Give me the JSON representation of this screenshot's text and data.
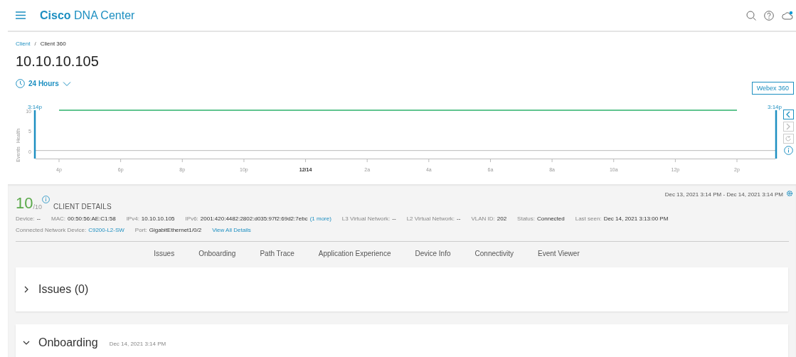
{
  "header": {
    "brand_bold": "Cisco",
    "brand": "DNA Center"
  },
  "breadcrumb": [
    {
      "label": "Client",
      "kind": "link"
    },
    {
      "label": "/",
      "kind": "separator"
    },
    {
      "label": "Client 360",
      "kind": "current"
    }
  ],
  "title": "10.10.10.105",
  "time_range": {
    "label": "24 Hours"
  },
  "webex_button": "Webex 360",
  "timeline": {
    "events_label": "Events",
    "start_marker": "3:14p",
    "end_marker": "3:14p",
    "chart_data": {
      "type": "line",
      "ylabel": "Health",
      "ylim": [
        -2,
        10
      ],
      "yticks": [
        0,
        5,
        10
      ],
      "categories": [
        "4p",
        "6p",
        "8p",
        "10p",
        "12/14",
        "2a",
        "4a",
        "6a",
        "8a",
        "10a",
        "12p",
        "2p"
      ],
      "series": [
        {
          "color": "#2bb06a",
          "values": [
            10,
            10,
            10,
            10,
            10,
            10,
            10,
            10,
            10,
            10,
            10,
            10
          ]
        }
      ]
    },
    "controls": [
      {
        "kind": "back",
        "disabled": false
      },
      {
        "kind": "forward",
        "disabled": true
      },
      {
        "kind": "reset",
        "disabled": true
      }
    ]
  },
  "client": {
    "score": "10",
    "score_max": "/10",
    "heading": "CLIENT DETAILS",
    "date_range": "Dec 13, 2021 3:14 PM - Dec 14, 2021 3:14 PM",
    "identity": [
      {
        "label": "Device:",
        "value": "--",
        "kind": "text"
      },
      {
        "label": "MAC:",
        "value": "00:50:56:AE:C1:58",
        "kind": "text"
      },
      {
        "label": "IPv4:",
        "value": "10.10.10.105",
        "kind": "text"
      },
      {
        "label": "IPv6:",
        "value": "2001:420:4482:2802:d035:97f2:69d2:7ebc",
        "link": "(1 more)",
        "kind": "text"
      },
      {
        "label": "L3 Virtual Network:",
        "value": "--",
        "kind": "text"
      },
      {
        "label": "L2 Virtual Network:",
        "value": "--",
        "kind": "text"
      },
      {
        "label": "VLAN ID:",
        "value": "202",
        "kind": "text"
      },
      {
        "label": "Status:",
        "value": "Connected",
        "kind": "text"
      },
      {
        "label": "Last seen:",
        "value": "Dec 14, 2021 3:13:00 PM",
        "kind": "text"
      }
    ],
    "connection": {
      "device_label": "Connected Network Device:",
      "device": "C9200-L2-SW",
      "port_label": "Port:",
      "port": "GigabitEthernet1/0/2"
    },
    "view_all": "View All Details"
  },
  "tabs": [
    {
      "label": "Issues",
      "selected": false
    },
    {
      "label": "Onboarding",
      "selected": false
    },
    {
      "label": "Path Trace",
      "selected": false
    },
    {
      "label": "Application Experience",
      "selected": false
    },
    {
      "label": "Device Info",
      "selected": false
    },
    {
      "label": "Connectivity",
      "selected": false
    },
    {
      "label": "Event Viewer",
      "selected": false
    }
  ],
  "sections": [
    {
      "title": "Issues (0)",
      "expanded": false
    },
    {
      "title": "Onboarding",
      "subtitle": "Dec 14, 2021 3:14 PM",
      "expanded": true
    }
  ]
}
